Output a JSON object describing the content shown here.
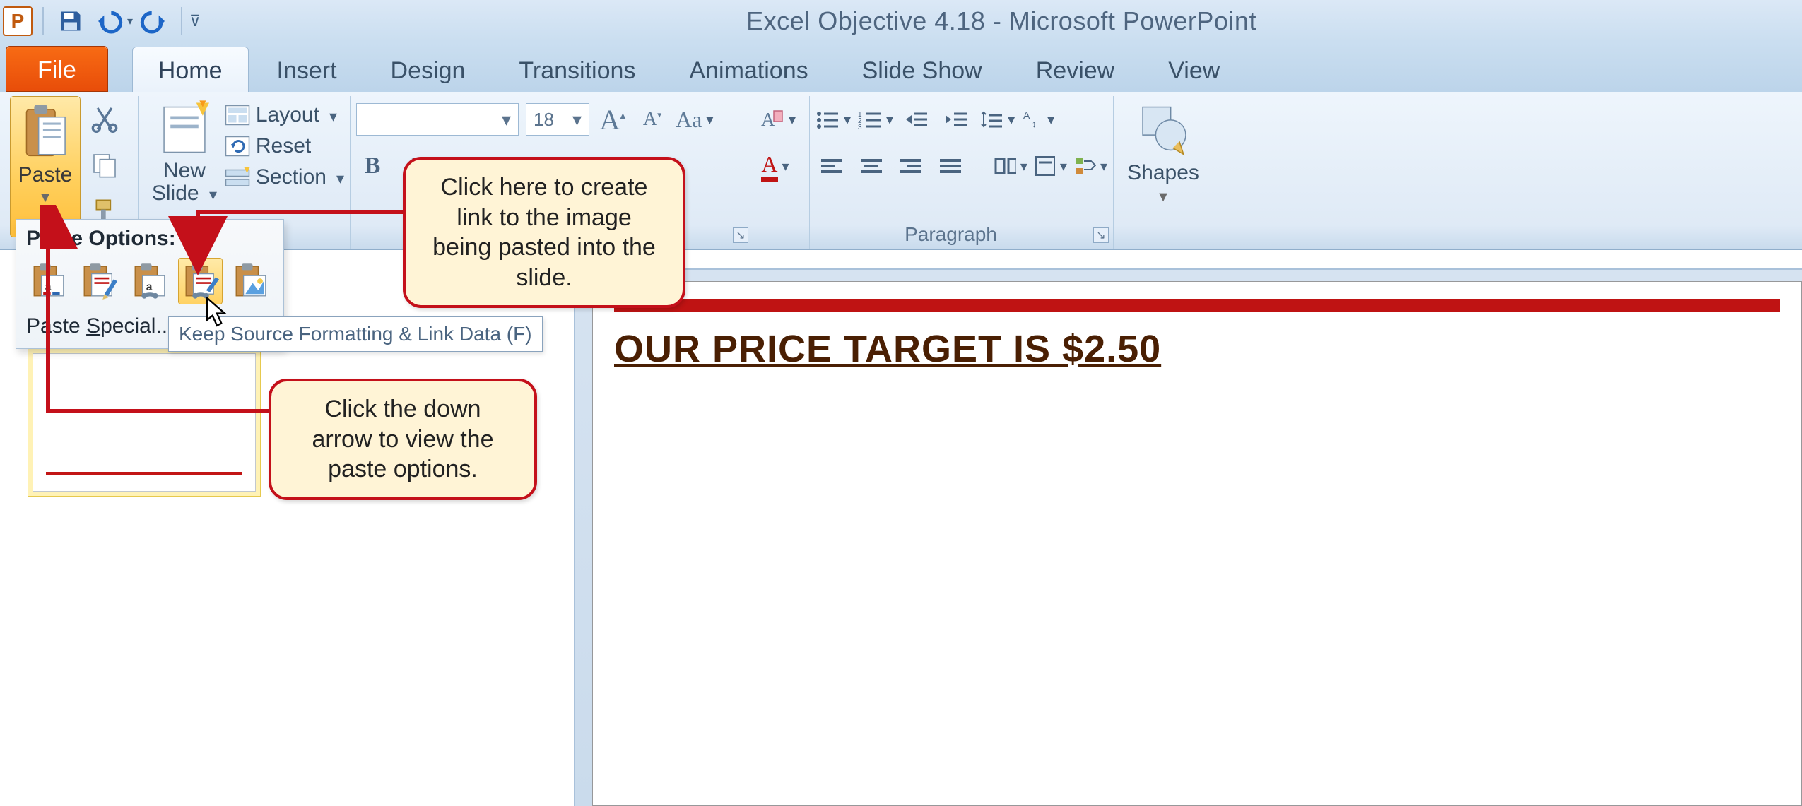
{
  "window": {
    "title": "Excel Objective 4.18  -  Microsoft PowerPoint"
  },
  "tabs": {
    "file": "File",
    "items": [
      "Home",
      "Insert",
      "Design",
      "Transitions",
      "Animations",
      "Slide Show",
      "Review",
      "View"
    ],
    "active_index": 0
  },
  "ribbon": {
    "clipboard": {
      "paste_label": "Paste"
    },
    "slides": {
      "new_slide_label": "New\nSlide",
      "layout_label": "Layout",
      "reset_label": "Reset",
      "section_label": "Section"
    },
    "font": {
      "size_value": "18"
    },
    "paragraph": {
      "group_label": "Paragraph"
    },
    "shapes": {
      "label": "Shapes"
    }
  },
  "paste_options": {
    "heading": "Paste Options:",
    "icons": [
      {
        "name": "use-destination-theme",
        "semantic": "use-destination-theme-icon"
      },
      {
        "name": "keep-source-formatting",
        "semantic": "keep-source-formatting-icon"
      },
      {
        "name": "embed",
        "semantic": "embed-icon"
      },
      {
        "name": "keep-source-formatting-link",
        "semantic": "keep-source-link-icon",
        "selected": true
      },
      {
        "name": "picture",
        "semantic": "picture-icon"
      }
    ],
    "special_label_pre": "Paste ",
    "special_label_u": "S",
    "special_label_post": "pecial...",
    "tooltip": "Keep Source Formatting & Link Data (F)"
  },
  "slide": {
    "title": "OUR PRICE TARGET IS $2.50"
  },
  "callouts": {
    "top": "Click here to create link to the image being pasted into the slide.",
    "bottom": "Click the down arrow to view the paste options."
  }
}
